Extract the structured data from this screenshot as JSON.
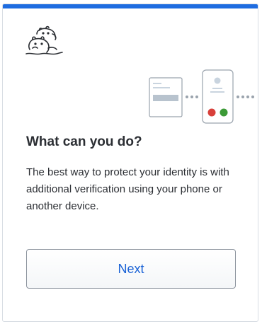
{
  "brand": {
    "accent_color": "#1e6ce0",
    "logo_icon": "hippo-logo-icon"
  },
  "illustration": {
    "icon": "device-verification-icon",
    "approve_color": "#3c9a37",
    "deny_color": "#d8403a"
  },
  "main": {
    "title": "What can you do?",
    "description": "The best way to protect your identity is with additional verification using your phone or another device."
  },
  "actions": {
    "next_label": "Next"
  }
}
